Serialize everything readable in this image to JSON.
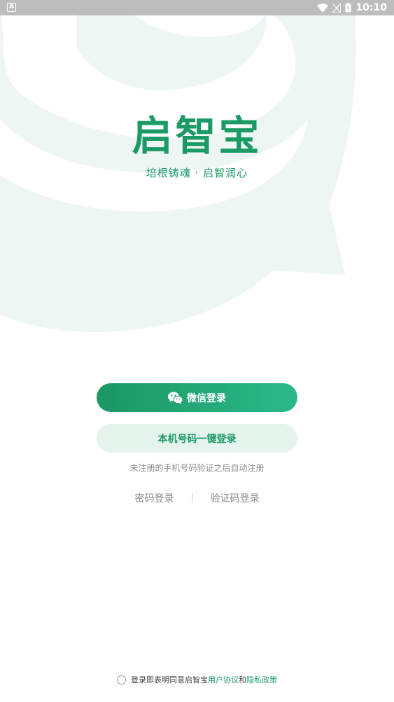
{
  "status_bar": {
    "time": "10:10",
    "left_icon": "notification-a-icon",
    "icons": [
      "wifi-icon",
      "signal-off-icon",
      "battery-charging-icon"
    ]
  },
  "brand": {
    "title": "启智宝",
    "slogan": "培根铸魂 · 启智润心"
  },
  "buttons": {
    "wechat_login": "微信登录",
    "phone_login": "本机号码一键登录"
  },
  "hint": "未注册的手机号码验证之后自动注册",
  "alt_login": {
    "password": "密码登录",
    "code": "验证码登录"
  },
  "agreement": {
    "prefix": "登录即表明同意启智宝",
    "user_agreement": "用户协议",
    "and": "和",
    "privacy_policy": "隐私政策",
    "checked": false
  },
  "colors": {
    "accent": "#1c9a66",
    "gradient_start": "#1b9763",
    "gradient_end": "#2bb98a",
    "light_button": "#e6f4ee",
    "watermark": "#edf6f2"
  }
}
